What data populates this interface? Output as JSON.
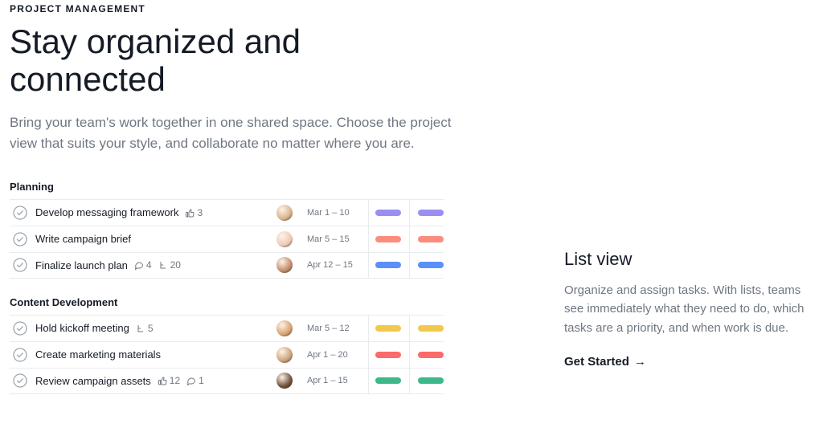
{
  "eyebrow": "PROJECT MANAGEMENT",
  "headline": "Stay organized and connected",
  "subhead": "Bring your team's work together in one shared space. Choose the project view that suits your style, and collaborate no matter where you are.",
  "sections": [
    {
      "label": "Planning",
      "tasks": [
        {
          "name": "Develop messaging framework",
          "likes": "3",
          "date": "Mar 1 – 10",
          "pill": "#9a8ff1",
          "avatar": "#d9b38c"
        },
        {
          "name": "Write campaign brief",
          "date": "Mar 5 – 15",
          "pill": "#fc8d7e",
          "avatar": "#eec9b7"
        },
        {
          "name": "Finalize launch plan",
          "comments": "4",
          "subtasks": "20",
          "date": "Apr 12 – 15",
          "pill": "#5b8ff9",
          "avatar": "#c28b6b"
        }
      ]
    },
    {
      "label": "Content Development",
      "tasks": [
        {
          "name": "Hold kickoff meeting",
          "subtasks": "5",
          "date": "Mar 5 – 12",
          "pill": "#f2c94c",
          "avatar": "#d4a373"
        },
        {
          "name": "Create marketing materials",
          "date": "Apr 1 – 20",
          "pill": "#fc6a6a",
          "avatar": "#c9a27a"
        },
        {
          "name": "Review campaign assets",
          "likes": "12",
          "comments": "1",
          "date": "Apr 1 – 15",
          "pill": "#3db88b",
          "avatar": "#6b4f3a"
        }
      ]
    }
  ],
  "right": {
    "title": "List view",
    "desc": "Organize and assign tasks. With lists, teams see immediately what they need to do, which tasks are a priority, and when work is due.",
    "cta": "Get Started"
  }
}
